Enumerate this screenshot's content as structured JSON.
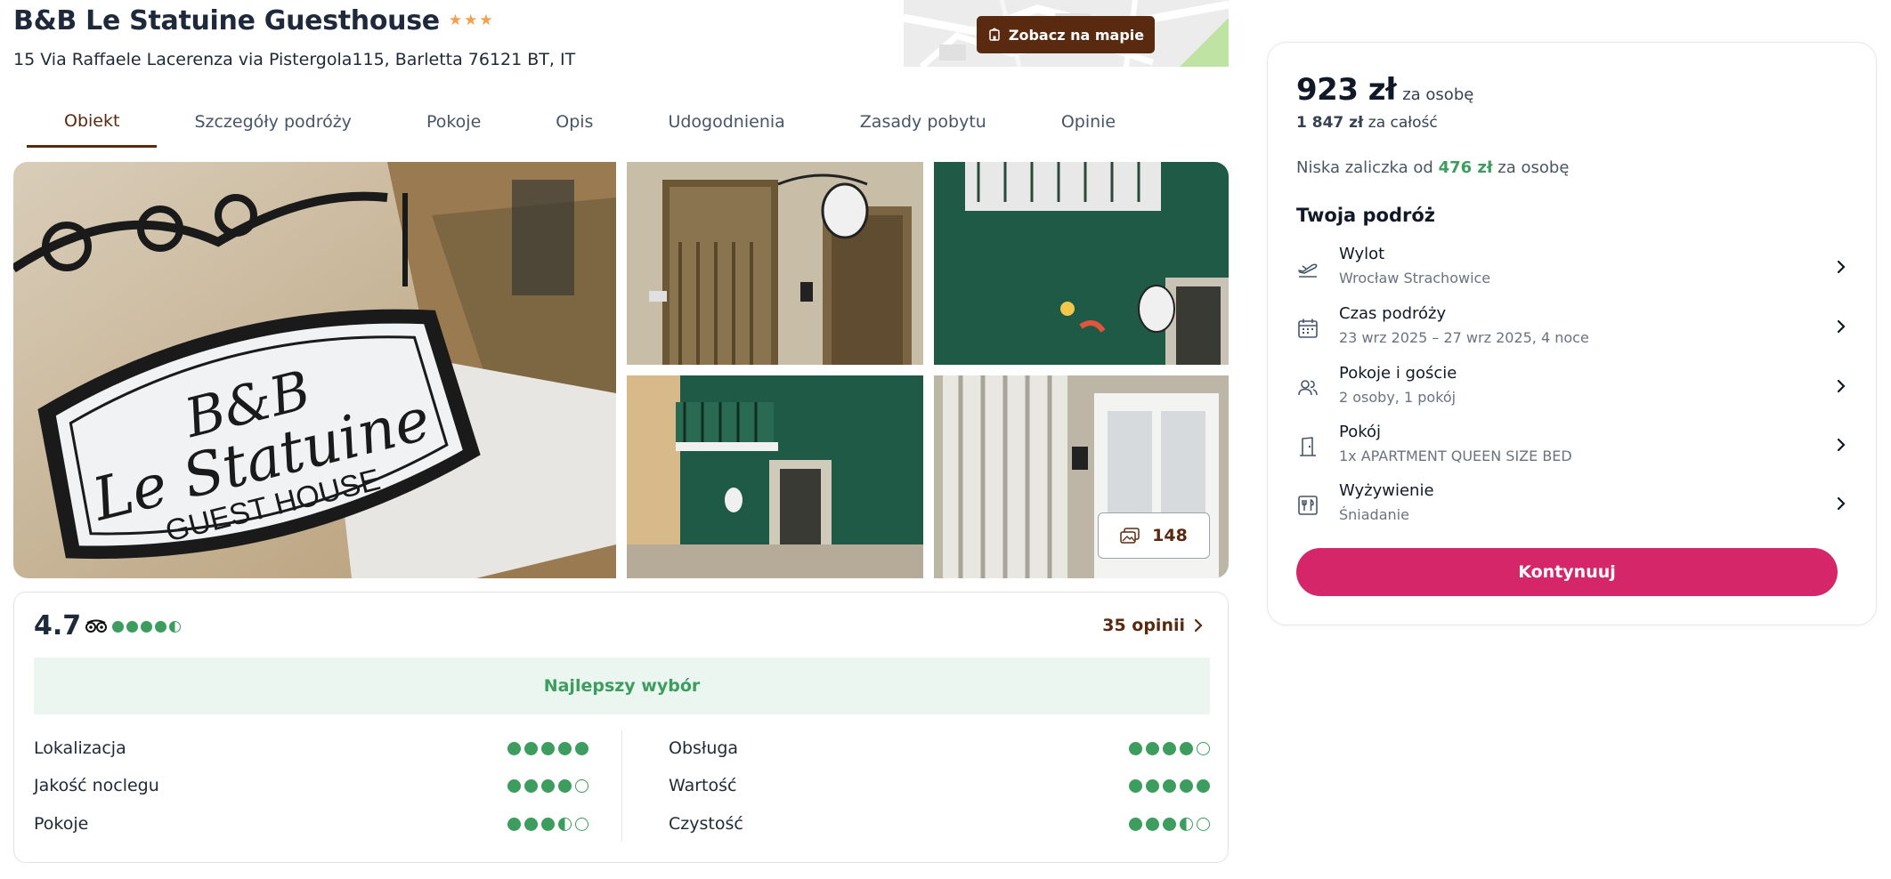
{
  "header": {
    "title": "B&B Le Statuine Guesthouse",
    "stars": 3,
    "address": "15 Via Raffaele Lacerenza via Pistergola115, Barletta 76121 BT, IT",
    "map_button": "Zobacz na mapie"
  },
  "tabs": [
    {
      "label": "Obiekt",
      "active": true
    },
    {
      "label": "Szczegóły podróży",
      "active": false
    },
    {
      "label": "Pokoje",
      "active": false
    },
    {
      "label": "Opis",
      "active": false
    },
    {
      "label": "Udogodnienia",
      "active": false
    },
    {
      "label": "Zasady pobytu",
      "active": false
    },
    {
      "label": "Opinie",
      "active": false
    }
  ],
  "gallery": {
    "photo_count": "148",
    "main_sign": {
      "line1": "B&B",
      "line2": "Le Statuine",
      "line3": "GUEST HOUSE"
    }
  },
  "reviews": {
    "score": "4.7",
    "tripadvisor_rating": 4.5,
    "opinions_link": "35 opinii",
    "badge": "Najlepszy wybór",
    "left": [
      {
        "label": "Lokalizacja",
        "rating": 5
      },
      {
        "label": "Jakość noclegu",
        "rating": 4
      },
      {
        "label": "Pokoje",
        "rating": 3.5
      }
    ],
    "right": [
      {
        "label": "Obsługa",
        "rating": 4
      },
      {
        "label": "Wartość",
        "rating": 5
      },
      {
        "label": "Czystość",
        "rating": 3.5
      }
    ]
  },
  "booking": {
    "price": "923 zł",
    "price_unit": "za osobę",
    "total_value": "1 847 zł",
    "total_unit": "za całość",
    "deposit_prefix": "Niska zaliczka od",
    "deposit_value": "476 zł",
    "deposit_suffix": "za osobę",
    "trip_title": "Twoja podróż",
    "items": [
      {
        "icon": "plane-departure-icon",
        "label": "Wylot",
        "value": "Wrocław Strachowice"
      },
      {
        "icon": "calendar-icon",
        "label": "Czas podróży",
        "value": "23 wrz 2025 – 27 wrz 2025, 4 noce"
      },
      {
        "icon": "guests-icon",
        "label": "Pokoje i goście",
        "value": "2 osoby, 1 pokój"
      },
      {
        "icon": "door-icon",
        "label": "Pokój",
        "value": "1x APARTMENT QUEEN SIZE BED"
      },
      {
        "icon": "cutlery-icon",
        "label": "Wyżywienie",
        "value": "Śniadanie"
      }
    ],
    "continue_label": "Kontynuuj"
  },
  "colors": {
    "brand_brown": "#5a2a10",
    "accent_pink": "#d6266a",
    "rating_green": "#3d9d5e",
    "badge_bg": "#eaf6ef",
    "star_orange": "#f59e4b"
  }
}
